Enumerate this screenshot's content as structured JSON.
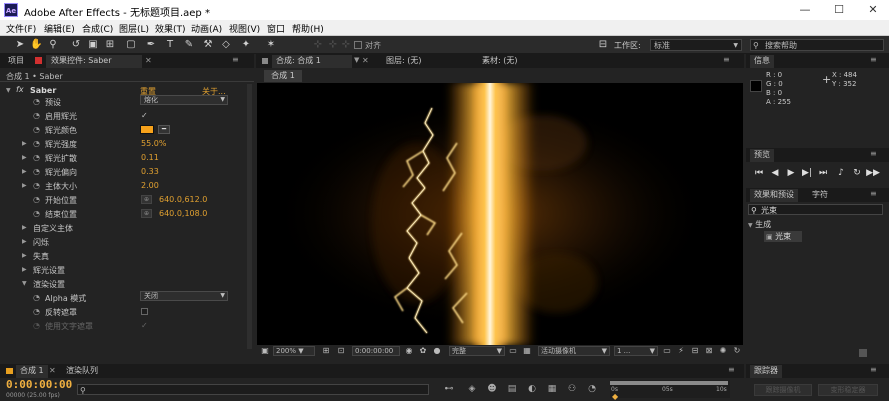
{
  "window": {
    "title": "Adobe After Effects - 无标题项目.aep *",
    "logo": "Ae",
    "minimize": "—",
    "maximize": "☐",
    "close": "✕"
  },
  "menu": [
    "文件(F)",
    "编辑(E)",
    "合成(C)",
    "图层(L)",
    "效果(T)",
    "动画(A)",
    "视图(V)",
    "窗口",
    "帮助(H)"
  ],
  "toolbar": {
    "align_label": "对齐",
    "workspace_label": "工作区:",
    "workspace_value": "标准",
    "search_placeholder": "搜索帮助"
  },
  "effect_controls": {
    "tab_project": "项目",
    "tab_effect": "效果控件: Saber",
    "subheader": "合成 1 • Saber",
    "effect_name": "Saber",
    "reset": "重置",
    "about": "关于...",
    "rows": [
      {
        "label": "预设",
        "value": "熔化"
      },
      {
        "label": "启用辉光",
        "value": "✓"
      },
      {
        "label": "辉光颜色",
        "value": ""
      },
      {
        "label": "辉光强度",
        "value": "55.0%"
      },
      {
        "label": "辉光扩散",
        "value": "0.11"
      },
      {
        "label": "辉光偏向",
        "value": "0.33"
      },
      {
        "label": "主体大小",
        "value": "2.00"
      },
      {
        "label": "开始位置",
        "value": "640.0,612.0"
      },
      {
        "label": "结束位置",
        "value": "640.0,108.0"
      },
      {
        "label": "自定义主体",
        "value": ""
      },
      {
        "label": "闪烁",
        "value": ""
      },
      {
        "label": "失真",
        "value": ""
      },
      {
        "label": "辉光设置",
        "value": ""
      },
      {
        "label": "渲染设置",
        "value": ""
      },
      {
        "label": "Alpha 模式",
        "value": "关闭"
      },
      {
        "label": "反转遮罩",
        "value": ""
      },
      {
        "label": "使用文字遮罩",
        "value": "✓"
      }
    ],
    "glow_color": "#f7a21b"
  },
  "composition": {
    "tab": "合成: 合成 1",
    "layer_label": "图层: (无)",
    "footage_label": "素材: (无)",
    "comp_tab": "合成 1",
    "zoom": "200%",
    "timecode": "0:00:00:00",
    "resolution": "完整",
    "camera": "活动摄像机",
    "views": "1 ..."
  },
  "info": {
    "tab": "信息",
    "r": "R : 0",
    "g": "G : 0",
    "b": "B : 0",
    "a": "A : 255",
    "x": "X : 484",
    "y": "Y : 352"
  },
  "preview": {
    "tab": "预览"
  },
  "effects_presets": {
    "tab": "效果和预设",
    "tab2": "字符",
    "search_value": "光束",
    "category": "生成",
    "item": "光束"
  },
  "timeline": {
    "tab": "合成 1",
    "tab2": "渲染队列",
    "timecode": "0:00:00:00",
    "fps": "00000 (25.00 fps)",
    "search_placeholder": "",
    "ruler": [
      "0s",
      "05s",
      "10s"
    ]
  },
  "tracker": {
    "tab": "跟踪器",
    "track_camera": "跟踪摄像机",
    "stabilize": "变形稳定器"
  }
}
